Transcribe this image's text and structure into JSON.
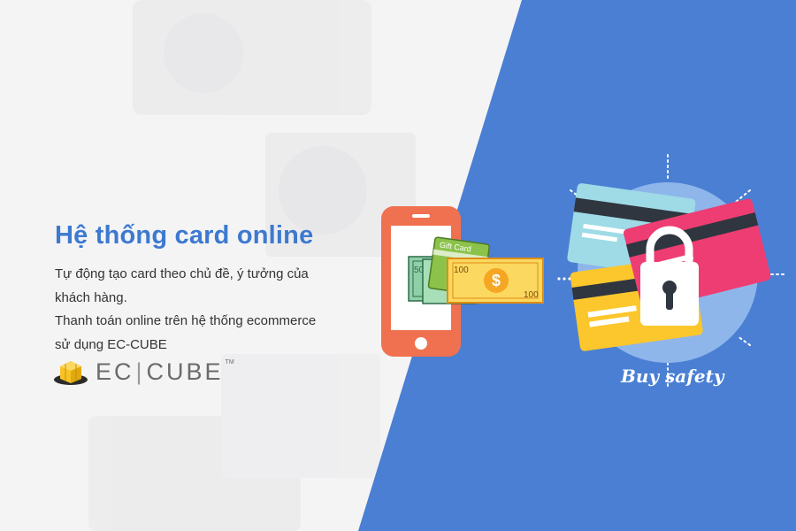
{
  "headline": "Hệ thống card online",
  "description_lines": [
    "Tự động tạo card theo chủ đề, ý tưởng của",
    "khách hàng.",
    "Thanh toán online trên hệ thống  ecommerce",
    "sử dụng EC-CUBE"
  ],
  "logo": {
    "left_text": "EC",
    "separator": "|",
    "right_text": "CUBE",
    "trademark": "TM"
  },
  "illustration": {
    "gift_card_label": "Gift Card",
    "bill_value_front": "100",
    "bill_value_back": "50",
    "currency_symbol": "$",
    "badge_text": "Buy safety"
  },
  "colors": {
    "accent_blue": "#4a7fd4",
    "headline_blue": "#3d79d0",
    "phone_orange": "#f0714f",
    "card_pink": "#ee3d72",
    "card_yellow": "#fcc72c",
    "card_teal": "#9fdbe6",
    "bill_yellow": "#fbd860",
    "gift_green": "#8bc34a"
  }
}
